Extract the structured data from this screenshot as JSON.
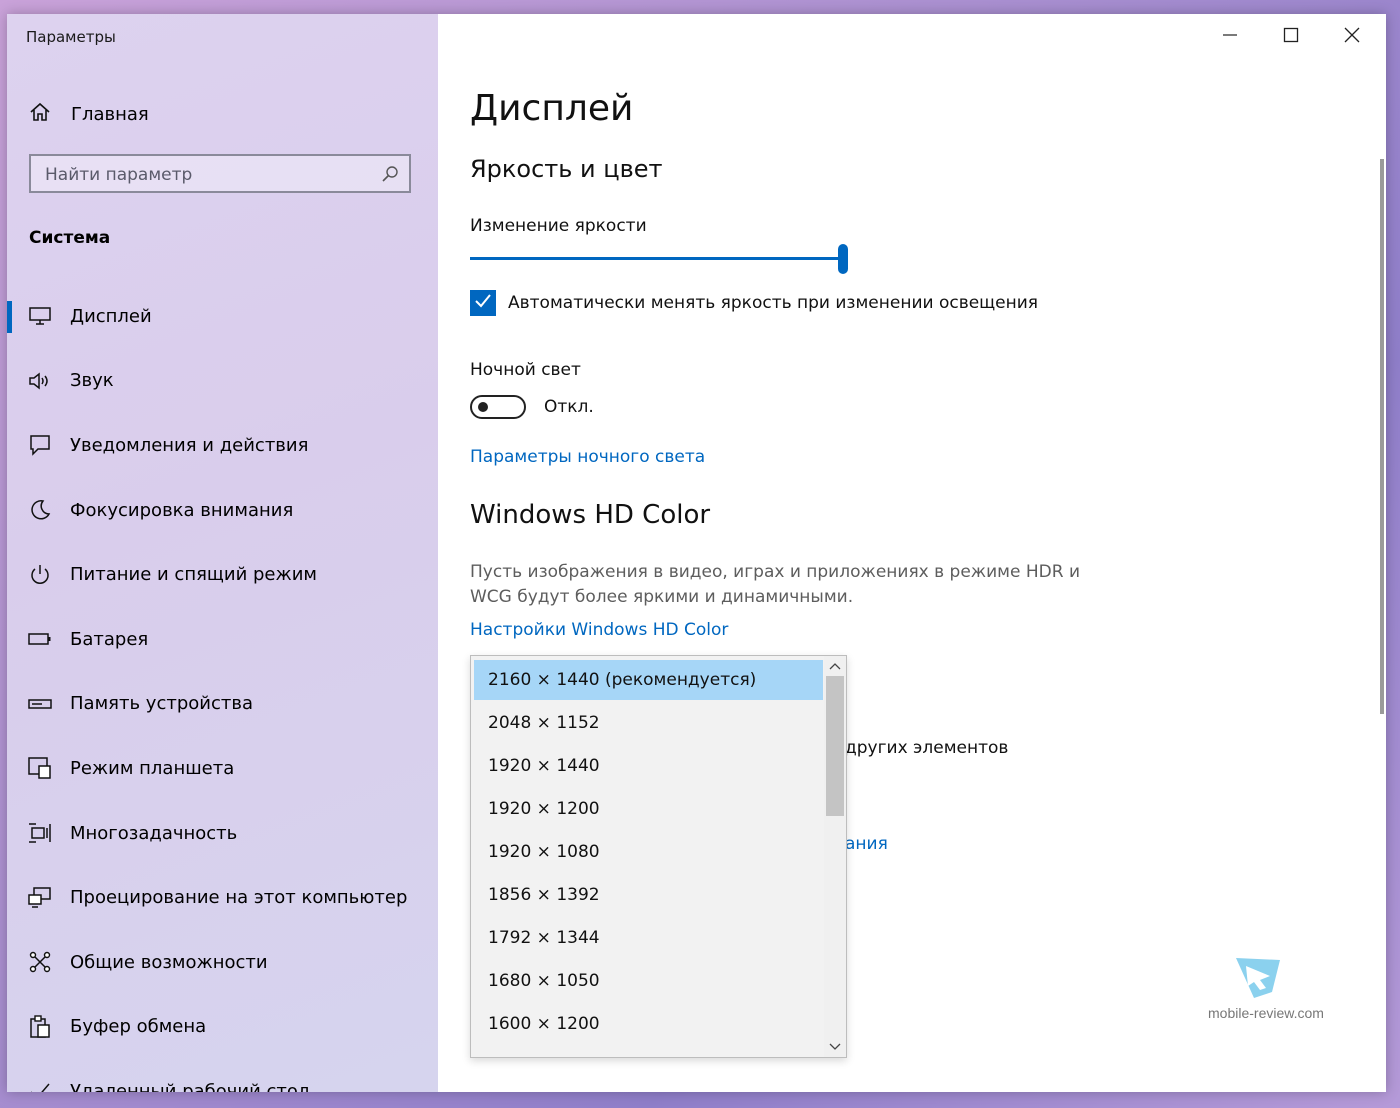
{
  "window": {
    "title": "Параметры"
  },
  "sidebar": {
    "home_label": "Главная",
    "search_placeholder": "Найти параметр",
    "section_title": "Система",
    "items": [
      {
        "label": "Дисплей",
        "icon": "monitor-icon",
        "active": true
      },
      {
        "label": "Звук",
        "icon": "speaker-icon"
      },
      {
        "label": "Уведомления и действия",
        "icon": "notification-icon"
      },
      {
        "label": "Фокусировка внимания",
        "icon": "moon-icon"
      },
      {
        "label": "Питание и спящий режим",
        "icon": "power-icon"
      },
      {
        "label": "Батарея",
        "icon": "battery-icon"
      },
      {
        "label": "Память устройства",
        "icon": "storage-icon"
      },
      {
        "label": "Режим планшета",
        "icon": "tablet-icon"
      },
      {
        "label": "Многозадачность",
        "icon": "multitask-icon"
      },
      {
        "label": "Проецирование на этот компьютер",
        "icon": "project-icon"
      },
      {
        "label": "Общие возможности",
        "icon": "shared-icon"
      },
      {
        "label": "Буфер обмена",
        "icon": "clipboard-icon"
      },
      {
        "label": "Удаленный рабочий стол",
        "icon": "remote-desktop-icon"
      }
    ]
  },
  "content": {
    "page_title": "Дисплей",
    "section_brightness": "Яркость и цвет",
    "brightness_label": "Изменение яркости",
    "brightness_value": 1.0,
    "auto_brightness_label": "Автоматически менять яркость при изменении освещения",
    "auto_brightness_checked": true,
    "night_light_label": "Ночной свет",
    "night_light_state": "Откл.",
    "night_light_link": "Параметры ночного света",
    "hd_title": "Windows HD Color",
    "hd_description": "Пусть изображения в видео, играх и приложениях в режиме HDR и WCG будут более яркими и динамичными.",
    "hd_link": "Настройки Windows HD Color",
    "behind_text_1": "других элементов",
    "behind_link_2": "ания"
  },
  "resolution_dropdown": {
    "selected": "2160 × 1440 (рекомендуется)",
    "options": [
      "2160 × 1440 (рекомендуется)",
      "2048 × 1152",
      "1920 × 1440",
      "1920 × 1200",
      "1920 × 1080",
      "1856 × 1392",
      "1792 × 1344",
      "1680 × 1050",
      "1600 × 1200"
    ]
  },
  "watermark": {
    "text": "mobile-review.com"
  },
  "colors": {
    "accent": "#0067c0",
    "selection": "#a6d6f7"
  }
}
